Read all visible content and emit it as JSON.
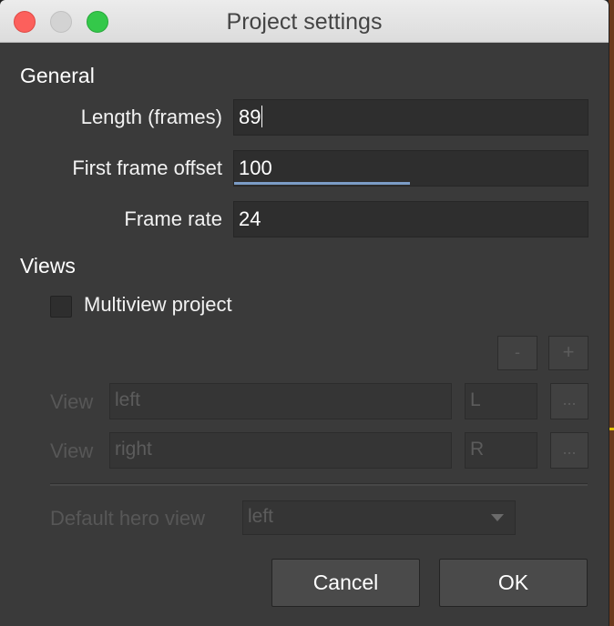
{
  "window": {
    "title": "Project settings"
  },
  "general": {
    "heading": "General",
    "length_label": "Length (frames)",
    "length_value": "89",
    "offset_label": "First frame offset",
    "offset_value": "100",
    "rate_label": "Frame rate",
    "rate_value": "24"
  },
  "views": {
    "heading": "Views",
    "multiview_label": "Multiview project",
    "multiview_checked": false,
    "remove_label": "-",
    "add_label": "+",
    "rows": [
      {
        "label": "View",
        "name": "left",
        "short": "L",
        "browse_label": "..."
      },
      {
        "label": "View",
        "name": "right",
        "short": "R",
        "browse_label": "..."
      }
    ],
    "hero_label": "Default hero view",
    "hero_value": "left"
  },
  "buttons": {
    "cancel": "Cancel",
    "ok": "OK"
  },
  "colors": {
    "window_bg": "#3a3a3a",
    "focus": "#7b9cc6",
    "close": "#fc605c",
    "maximize": "#34c84a"
  }
}
